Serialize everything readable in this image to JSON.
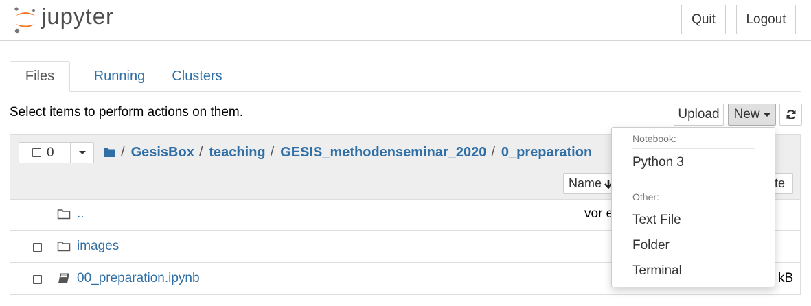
{
  "header": {
    "logo_text": "jupyter",
    "quit_label": "Quit",
    "logout_label": "Logout"
  },
  "tabs": [
    {
      "label": "Files"
    },
    {
      "label": "Running"
    },
    {
      "label": "Clusters"
    }
  ],
  "toolbar": {
    "hint": "Select items to perform actions on them.",
    "upload_label": "Upload",
    "new_label": "New"
  },
  "list": {
    "selected_count": "0",
    "breadcrumb": [
      "GesisBox",
      "teaching",
      "GESIS_methodenseminar_2020",
      "0_preparation"
    ],
    "sort_name_label": "Name",
    "sort_date_partial": "te",
    "rows": [
      {
        "name": "..",
        "meta": "vor e"
      },
      {
        "name": "images",
        "meta": ""
      },
      {
        "name": "00_preparation.ipynb",
        "meta": "kB"
      }
    ]
  },
  "new_menu": {
    "notebook_header": "Notebook:",
    "python_label": "Python 3",
    "other_header": "Other:",
    "text_file_label": "Text File",
    "folder_label": "Folder",
    "terminal_label": "Terminal"
  },
  "colors": {
    "link": "#2f6fa5",
    "logo_orange": "#f37726"
  }
}
